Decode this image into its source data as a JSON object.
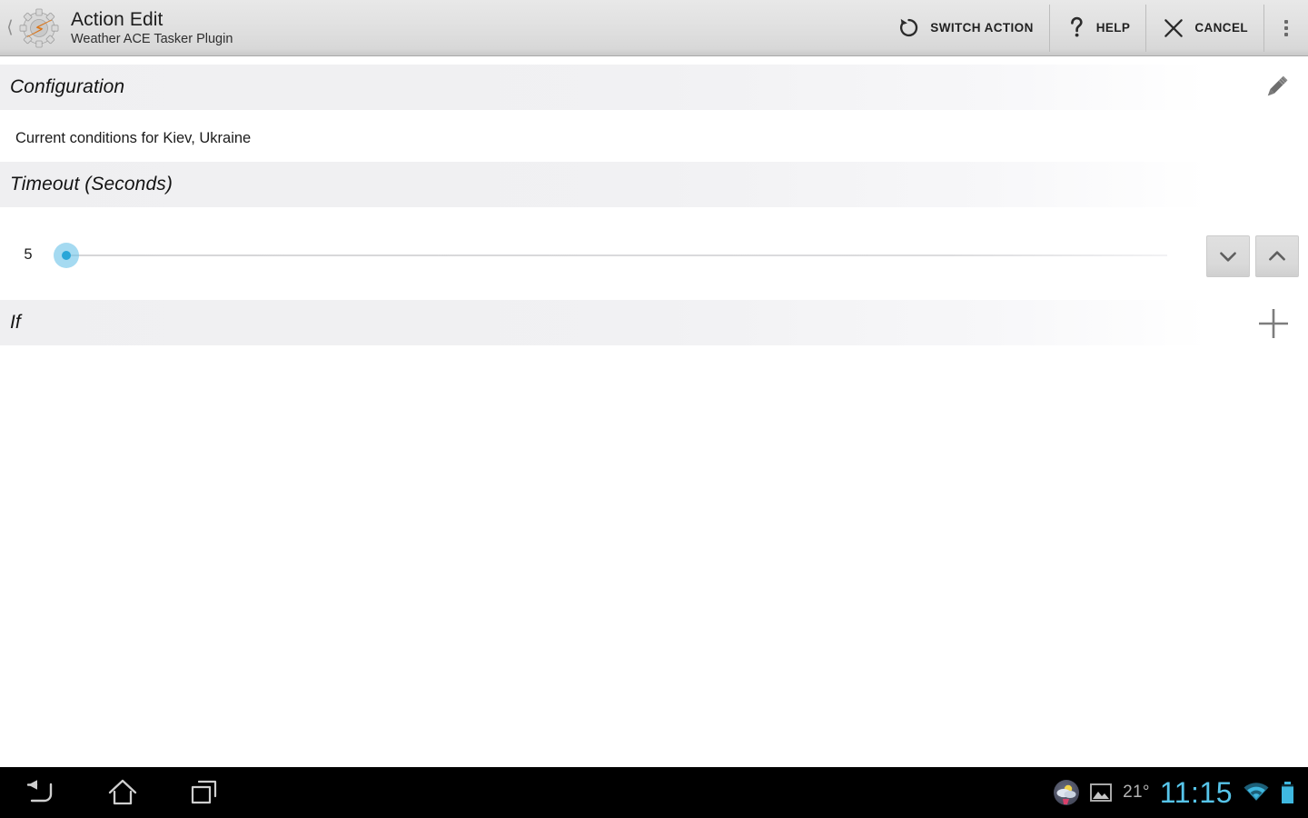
{
  "titlebar": {
    "back_icon": "back-chevron-icon",
    "app_icon": "tasker-gear-bolt-icon",
    "title": "Action Edit",
    "subtitle": "Weather ACE Tasker Plugin",
    "actions": [
      {
        "label": "SWITCH ACTION",
        "icon": "rotate-ccw-icon"
      },
      {
        "label": "HELP",
        "icon": "question-mark-icon"
      },
      {
        "label": "CANCEL",
        "icon": "close-x-icon"
      }
    ],
    "overflow_icon": "overflow-menu-icon"
  },
  "sections": {
    "configuration": {
      "header": "Configuration",
      "edit_icon": "pencil-icon",
      "description": "Current conditions for Kiev, Ukraine"
    },
    "timeout": {
      "header": "Timeout (Seconds)",
      "value": "5",
      "min": 0,
      "max": 100,
      "decrement_icon": "chevron-down-icon",
      "increment_icon": "chevron-up-icon"
    },
    "if": {
      "header": "If",
      "add_icon": "plus-icon"
    }
  },
  "navbar": {
    "back_icon": "back-arrow-icon",
    "home_icon": "home-icon",
    "recents_icon": "recent-apps-icon"
  },
  "statusbar": {
    "weather_icon": "weather-widget-icon",
    "screenshot_icon": "image-icon",
    "temperature": "21°",
    "clock": "11:15",
    "wifi_icon": "wifi-icon",
    "battery_icon": "battery-icon"
  },
  "colors": {
    "accent_blue": "#29a6d8",
    "status_cyan": "#57c5ea",
    "titlebar_gray": "#e2e2e2",
    "section_band": "#efeff1"
  }
}
